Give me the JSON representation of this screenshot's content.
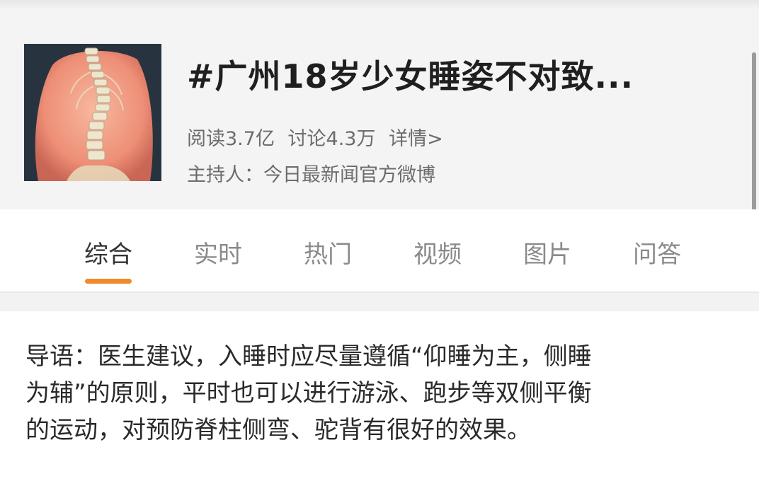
{
  "topic": {
    "title": "#广州18岁少女睡姿不对致...",
    "meta": {
      "read": "阅读3.7亿",
      "discuss": "讨论4.3万",
      "details": "详情>"
    },
    "host": "主持人：今日最新闻官方微博"
  },
  "tabs": [
    "综合",
    "实时",
    "热门",
    "视频",
    "图片",
    "问答"
  ],
  "active_tab": "综合",
  "intro_lines": [
    "导语：医生建议，入睡时应尽量遵循“仰睡为主，侧睡",
    "为辅”的原则，平时也可以进行游泳、跑步等双侧平衡",
    "的运动，对预防脊柱侧弯、驼背有很好的效果。"
  ],
  "colors": {
    "accent": "#f08a2d",
    "header_bg": "#f4f4f4",
    "text": "#222222",
    "muted": "#6c6c6c"
  },
  "icons": {
    "thumbnail": "spine-illustration"
  }
}
